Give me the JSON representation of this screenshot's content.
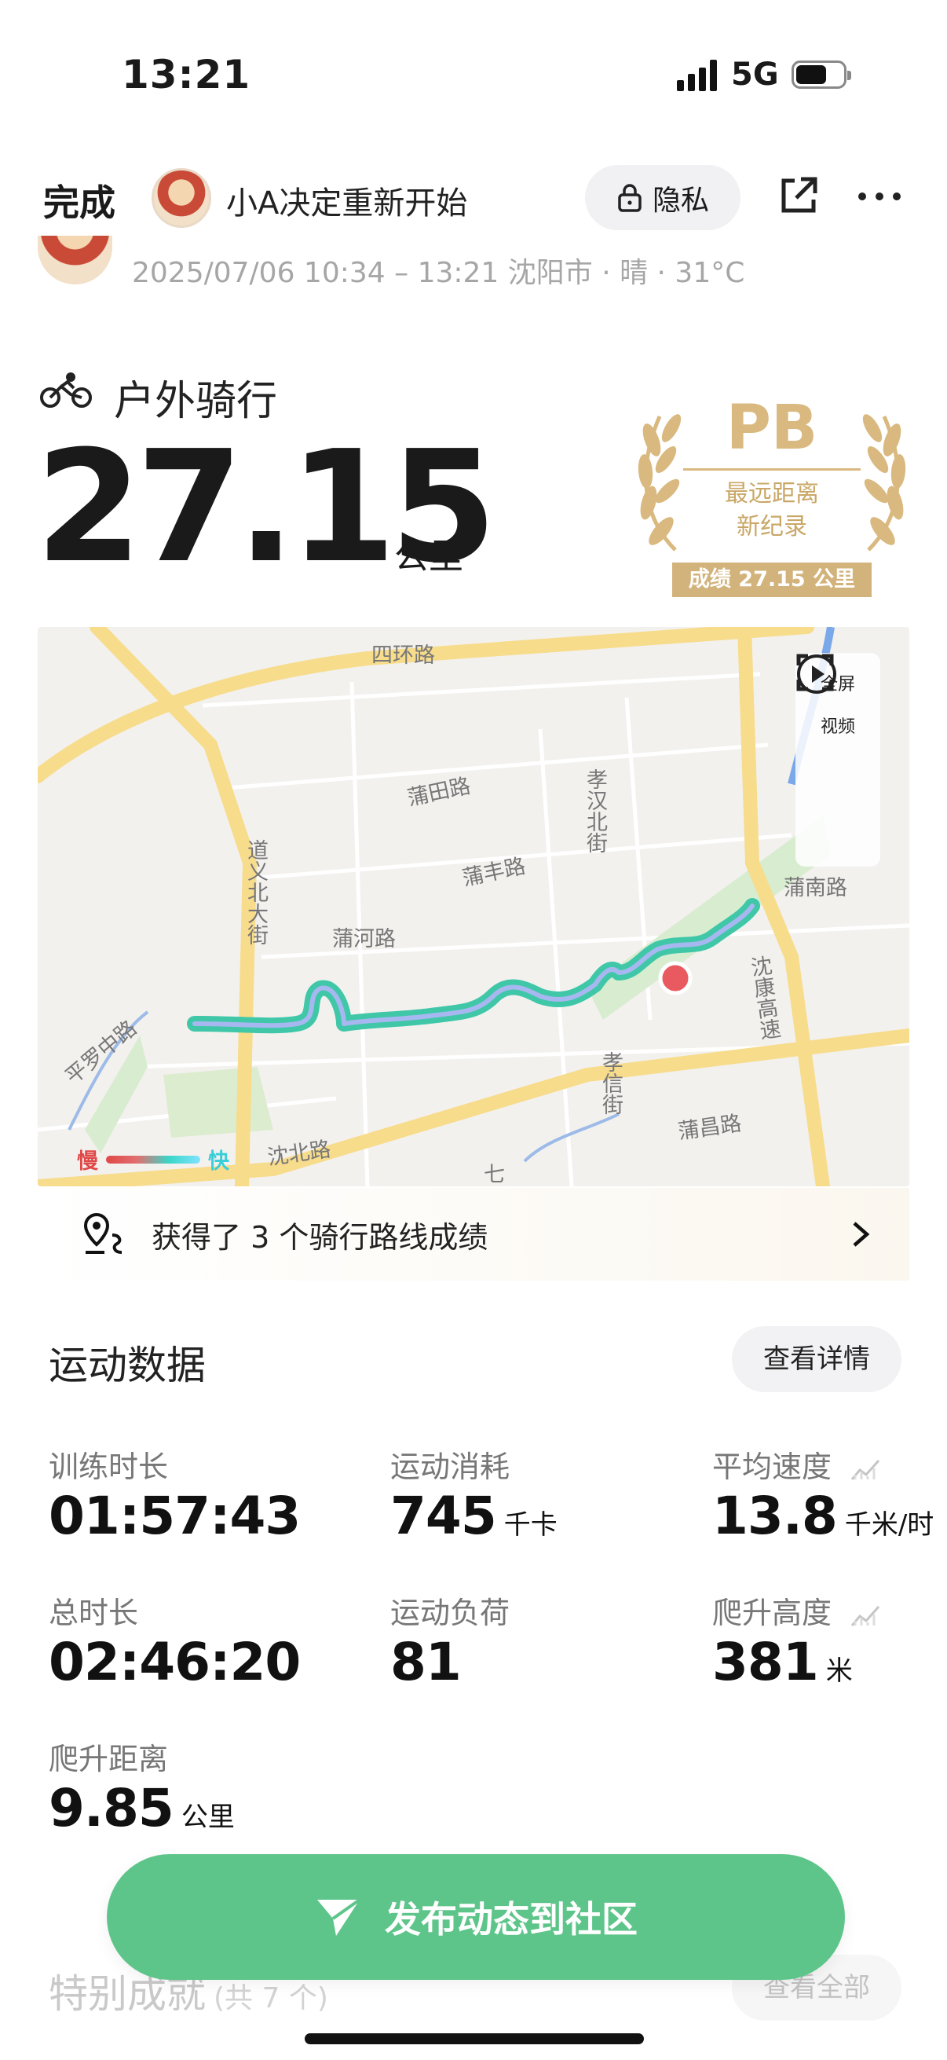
{
  "status_bar": {
    "time": "13:21",
    "network": "5G"
  },
  "header": {
    "done_label": "完成",
    "username": "小A决定重新开始",
    "privacy_label": "隐私",
    "meta": "2025/07/06 10:34 – 13:21 沈阳市 · 晴 · 31°C"
  },
  "activity": {
    "type": "户外骑行",
    "distance": "27.15",
    "distance_unit": "公里"
  },
  "pb_badge": {
    "title": "PB",
    "line1": "最远距离",
    "line2": "新纪录",
    "score": "成绩 27.15 公里",
    "color": "#d9b97f"
  },
  "map": {
    "fullscreen_label": "全屏",
    "video_label": "视频",
    "roads": [
      "四环路",
      "蒲田路",
      "孝汉北街",
      "蒲丰路",
      "道义北大街",
      "蒲河路",
      "蒲南路",
      "沈康高速",
      "平罗中路",
      "孝信街",
      "蒲昌路",
      "沈北路",
      "七"
    ],
    "speed_slow": "慢",
    "speed_fast": "快",
    "route_color": "#3fc7a8",
    "end_marker_color": "#e85a5f"
  },
  "route_banner": {
    "text": "获得了 3 个骑行路线成绩"
  },
  "stats": {
    "title": "运动数据",
    "detail_button": "查看详情",
    "items": [
      {
        "label": "训练时长",
        "value": "01:57:43",
        "unit": ""
      },
      {
        "label": "运动消耗",
        "value": "745",
        "unit": "千卡"
      },
      {
        "label": "平均速度",
        "value": "13.8",
        "unit": "千米/时"
      },
      {
        "label": "总时长",
        "value": "02:46:20",
        "unit": ""
      },
      {
        "label": "运动负荷",
        "value": "81",
        "unit": ""
      },
      {
        "label": "爬升高度",
        "value": "381",
        "unit": "米"
      },
      {
        "label": "爬升距离",
        "value": "9.85",
        "unit": "公里"
      }
    ]
  },
  "publish_button": {
    "label": "发布动态到社区",
    "color": "#5ec58a"
  },
  "special": {
    "title": "特别成就",
    "count": "(共 7 个)",
    "view_all": "查看全部"
  }
}
